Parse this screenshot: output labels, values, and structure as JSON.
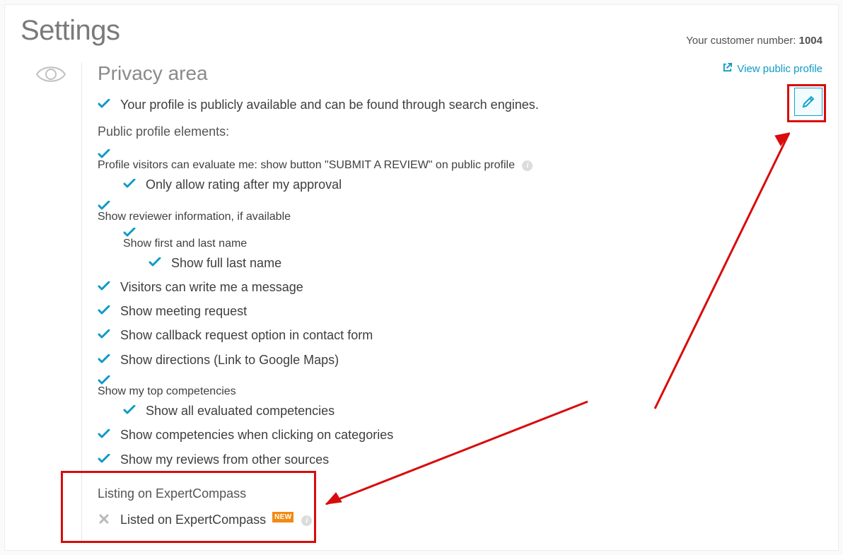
{
  "page_title": "Settings",
  "customer_label": "Your customer number:",
  "customer_number": "1004",
  "section_title": "Privacy area",
  "view_public_profile": "View public profile",
  "profile_public_line": "Your profile is publicly available and can be found through search engines.",
  "public_elements_heading": "Public profile elements:",
  "items": {
    "evaluate": "Profile visitors can evaluate me: show button \"SUBMIT A REVIEW\" on public profile",
    "approval": "Only allow rating after my approval",
    "reviewer_info": "Show reviewer information, if available",
    "first_last": "Show first and last name",
    "full_last": "Show full last name",
    "message": "Visitors can write me a message",
    "meeting": "Show meeting request",
    "callback": "Show callback request option in contact form",
    "directions": "Show directions (Link to Google Maps)",
    "top_comp": "Show my top competencies",
    "all_comp": "Show all evaluated competencies",
    "comp_cat": "Show competencies when clicking on categories",
    "other_src": "Show my reviews from other sources"
  },
  "listing_heading": "Listing on ExpertCompass",
  "listing_item": "Listed on ExpertCompass",
  "badge_new": "NEW",
  "colors": {
    "accent": "#0f9ac5",
    "annotation": "#d90b0b",
    "badge": "#f28a10"
  }
}
